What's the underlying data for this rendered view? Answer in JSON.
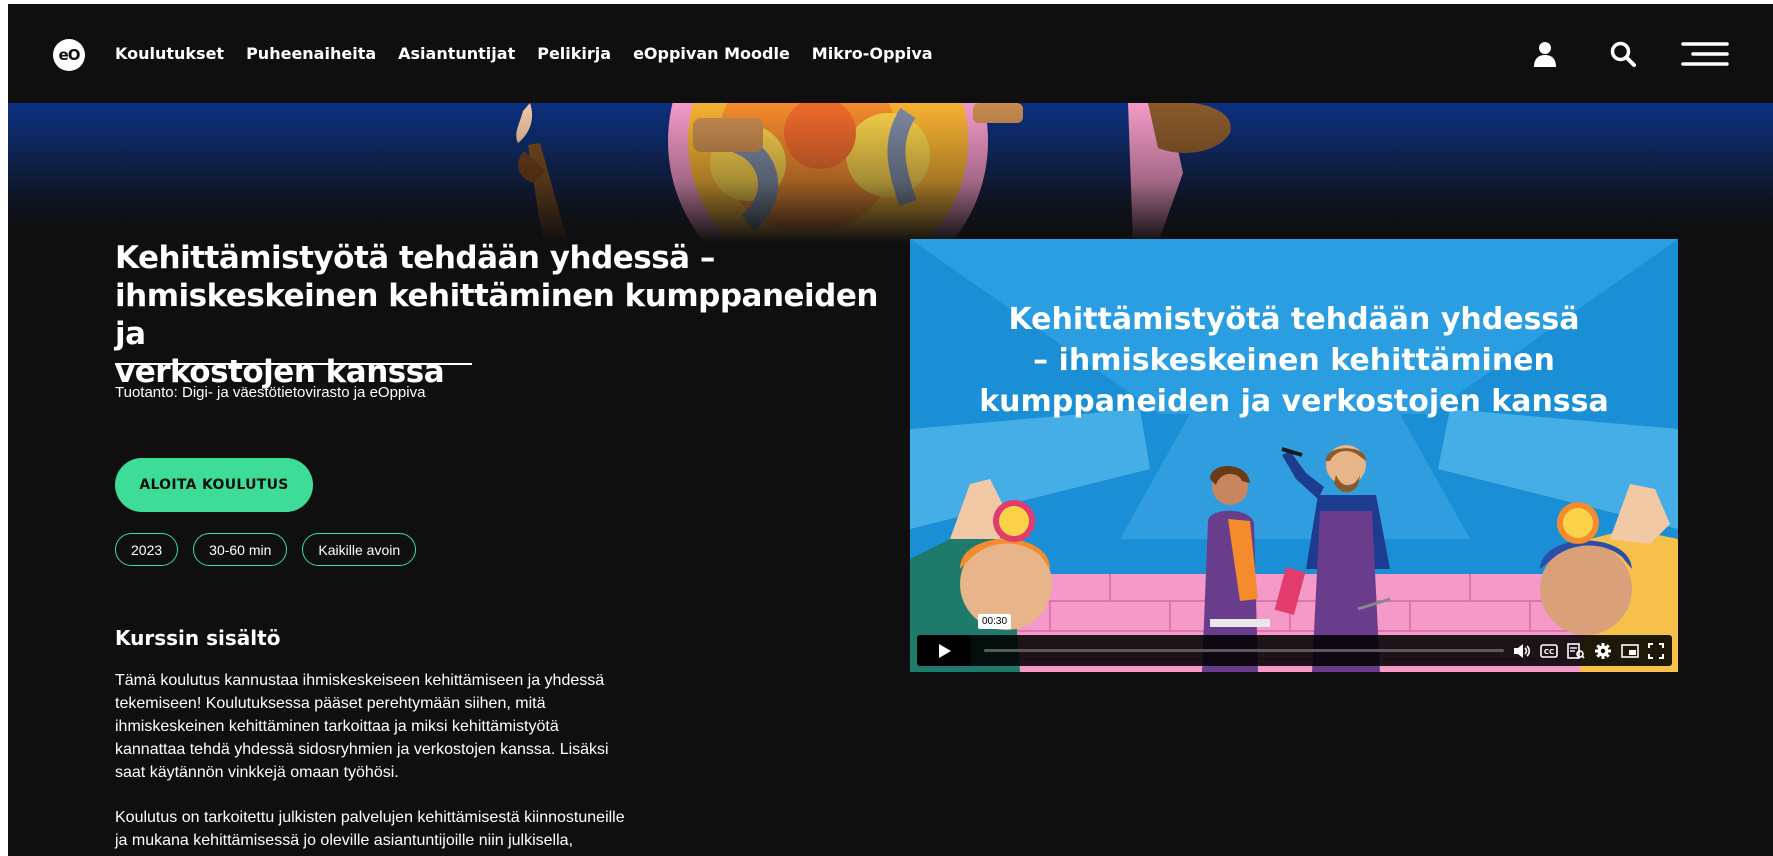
{
  "header": {
    "logo_text": "eO",
    "nav": [
      "Koulutukset",
      "Puheenaiheita",
      "Asiantuntijat",
      "Pelikirja",
      "eOppivan Moodle",
      "Mikro-Oppiva"
    ],
    "icons": [
      "user-icon",
      "search-icon",
      "menu-icon"
    ]
  },
  "course": {
    "title_lines": [
      "Kehittämistyötä tehdään yhdessä –",
      "ihmiskeskeinen kehittäminen kumppaneiden ja",
      "verkostojen kanssa"
    ],
    "producer": "Tuotanto: Digi- ja väestötietovirasto ja eOppiva",
    "cta": "ALOITA KOULUTUS",
    "tags": [
      "2023",
      "30-60 min",
      "Kaikille avoin"
    ]
  },
  "content": {
    "heading": "Kurssin sisältö",
    "p1_lines": [
      "Tämä koulutus kannustaa ihmiskeskeiseen kehittämiseen ja yhdessä",
      "tekemiseen! Koulutuksessa pääset perehtymään siihen, mitä",
      "ihmiskeskeinen kehittäminen tarkoittaa ja miksi kehittämistyötä",
      "kannattaa tehdä yhdessä sidosryhmien ja verkostojen kanssa. Lisäksi",
      "saat käytännön vinkkejä omaan työhösi."
    ],
    "p2_lines": [
      "Koulutus on tarkoitettu julkisten palvelujen kehittämisestä kiinnostuneille",
      "ja mukana kehittämisessä jo oleville asiantuntijoille niin julkisella,"
    ]
  },
  "video": {
    "title_lines": [
      "Kehittämistyötä tehdään yhdessä",
      "– ihmiskeskeinen kehittäminen",
      "kumppaneiden ja verkostojen kanssa"
    ],
    "duration_tooltip": "00:30",
    "controls": [
      "play-icon",
      "volume-icon",
      "captions-icon",
      "transcript-icon",
      "settings-icon",
      "picture-in-picture-icon",
      "fullscreen-icon"
    ]
  },
  "colors": {
    "page_bg": "#0f0f0f",
    "accent": "#3ddc97",
    "hero_blue": "#0b2f82",
    "video_blue": "#1b8fd6",
    "brick_pink": "#f59ac8"
  }
}
